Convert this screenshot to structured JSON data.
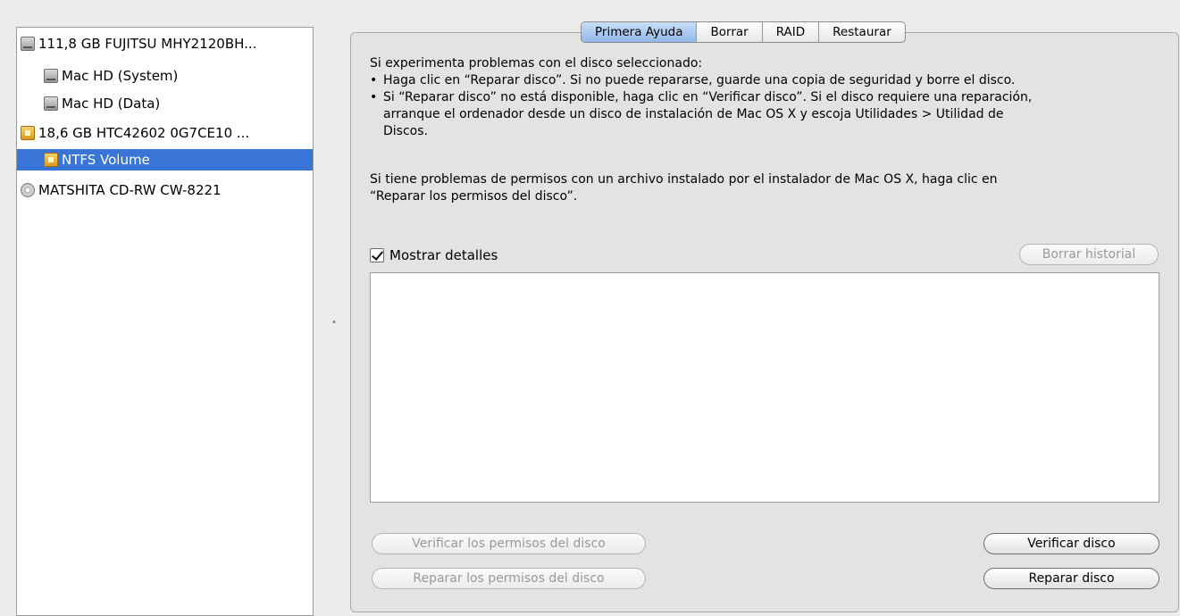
{
  "sidebar": {
    "items": [
      {
        "label": "111,8 GB FUJITSU MHY2120BH...",
        "icon": "hard-disk-icon"
      },
      {
        "label": "Mac HD (System)",
        "icon": "hard-disk-icon"
      },
      {
        "label": "Mac HD (Data)",
        "icon": "hard-disk-icon"
      },
      {
        "label": "18,6 GB HTC42602 0G7CE10 ...",
        "icon": "external-disk-icon"
      },
      {
        "label": "NTFS Volume",
        "icon": "external-disk-icon",
        "selected": true
      },
      {
        "label": "MATSHITA CD-RW CW-8221",
        "icon": "cd-drive-icon"
      }
    ]
  },
  "tabs": [
    {
      "label": "Primera Ayuda",
      "active": true
    },
    {
      "label": "Borrar"
    },
    {
      "label": "RAID"
    },
    {
      "label": "Restaurar"
    }
  ],
  "first_aid": {
    "intro": "Si experimenta problemas con el disco seleccionado:",
    "bullet1": "Haga clic en “Reparar disco”. Si no puede repararse, guarde una copia de seguridad y borre el disco.",
    "bullet2_line1": "Si “Reparar disco” no está disponible, haga clic en “Verificar disco”. Si el disco requiere una reparación,",
    "bullet2_line2": "arranque el ordenador desde un disco de instalación de Mac OS X y escoja Utilidades > Utilidad de",
    "bullet2_line3": "Discos.",
    "permissions_line1": "Si tiene problemas de permisos con un archivo instalado por el instalador de Mac OS X, haga clic en",
    "permissions_line2": "“Reparar los permisos del disco”.",
    "show_details_label": "Mostrar detalles",
    "show_details_checked": true,
    "clear_history_label": "Borrar historial",
    "verify_permissions_label": "Verificar los permisos del disco",
    "repair_permissions_label": "Reparar los permisos del disco",
    "verify_disk_label": "Verificar disco",
    "repair_disk_label": "Reparar disco"
  },
  "colors": {
    "selection": "#3875d7",
    "active_tab": "#a9ccf2"
  }
}
